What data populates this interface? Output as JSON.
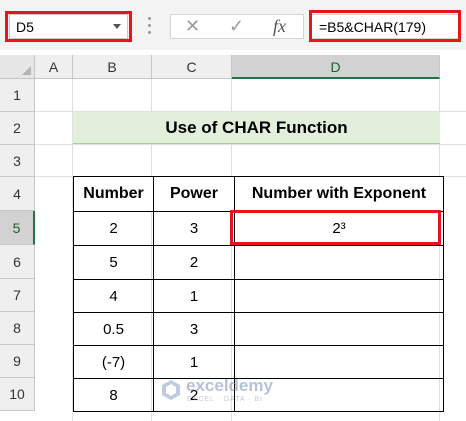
{
  "name_box": {
    "value": "D5"
  },
  "formula_bar": {
    "cancel_icon": "x-icon",
    "enter_icon": "check-icon",
    "fx_label": "fx",
    "formula": "=B5&CHAR(179)"
  },
  "columns": [
    "A",
    "B",
    "C",
    "D"
  ],
  "rows": [
    "1",
    "2",
    "3",
    "4",
    "5",
    "6",
    "7",
    "8",
    "9",
    "10"
  ],
  "active_cell": {
    "column": "D",
    "row": "5"
  },
  "title": "Use of CHAR Function",
  "table": {
    "headers": [
      "Number",
      "Power",
      "Number with Exponent"
    ],
    "rows": [
      {
        "number": "2",
        "power": "3",
        "result": "2³"
      },
      {
        "number": "5",
        "power": "2",
        "result": ""
      },
      {
        "number": "4",
        "power": "1",
        "result": ""
      },
      {
        "number": "0.5",
        "power": "3",
        "result": ""
      },
      {
        "number": "(-7)",
        "power": "1",
        "result": ""
      },
      {
        "number": "8",
        "power": "2",
        "result": ""
      }
    ]
  },
  "watermark": {
    "name": "exceldemy",
    "tagline": "EXCEL · DATA · BI"
  },
  "colors": {
    "highlight_border": "#e8141c",
    "title_fill": "#e2efda",
    "excel_green": "#217346"
  }
}
